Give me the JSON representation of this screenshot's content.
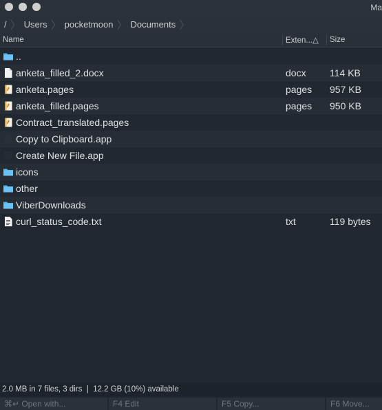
{
  "window": {
    "title": "Ma"
  },
  "breadcrumb": {
    "root": "/",
    "items": [
      "Users",
      "pocketmoon",
      "Documents"
    ]
  },
  "columns": {
    "name": "Name",
    "extension": "Exten...△",
    "size": "Size"
  },
  "files": [
    {
      "name": "..",
      "ext": "",
      "size": "",
      "icon": "folder-icon"
    },
    {
      "name": "anketa_filled_2.docx",
      "ext": "docx",
      "size": "114 KB",
      "icon": "document-icon"
    },
    {
      "name": "anketa.pages",
      "ext": "pages",
      "size": "957 KB",
      "icon": "pages-icon"
    },
    {
      "name": "anketa_filled.pages",
      "ext": "pages",
      "size": "950 KB",
      "icon": "pages-icon"
    },
    {
      "name": "Contract_translated.pages",
      "ext": "",
      "size": "",
      "icon": "pages-icon"
    },
    {
      "name": "Copy to Clipboard.app",
      "ext": "",
      "size": "",
      "icon": "app-icon"
    },
    {
      "name": "Create New File.app",
      "ext": "",
      "size": "",
      "icon": "app-icon"
    },
    {
      "name": "icons",
      "ext": "",
      "size": "",
      "icon": "folder-icon"
    },
    {
      "name": "other",
      "ext": "",
      "size": "",
      "icon": "folder-icon"
    },
    {
      "name": "ViberDownloads",
      "ext": "",
      "size": "",
      "icon": "folder-icon"
    },
    {
      "name": "curl_status_code.txt",
      "ext": "txt",
      "size": "119 bytes",
      "icon": "text-file-icon"
    }
  ],
  "status": {
    "text": "2.0 MB in 7 files, 3 dirs  |  12.2 GB (10%) available"
  },
  "function_keys": [
    {
      "label": "⌘↵ Open with..."
    },
    {
      "label": "F4 Edit"
    },
    {
      "label": "F5 Copy..."
    },
    {
      "label": "F6 Move..."
    }
  ],
  "colors": {
    "background": "#222830",
    "folder": "#5bb6ec",
    "text": "#dde0e4"
  }
}
